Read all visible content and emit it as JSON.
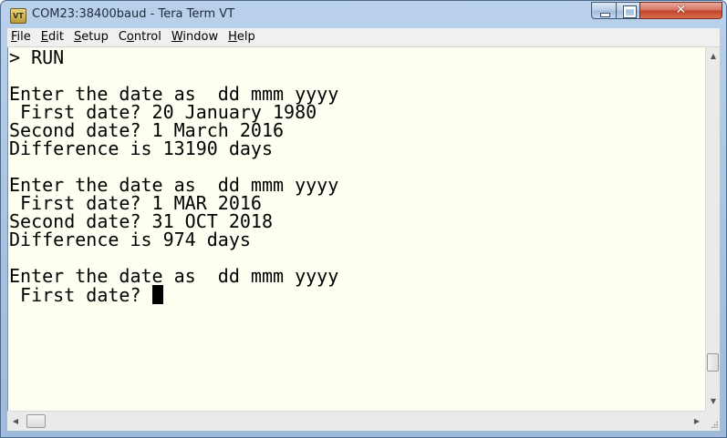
{
  "window": {
    "title": "COM23:38400baud - Tera Term VT",
    "app_icon": "tera-term-icon",
    "icon_text": "VT"
  },
  "caption_buttons": {
    "minimize_icon": "minimize-icon",
    "maximize_icon": "maximize-icon",
    "close_icon": "close-icon",
    "close_glyph": "✕"
  },
  "menu": [
    {
      "accel": "F",
      "rest": "ile"
    },
    {
      "accel": "E",
      "rest": "dit"
    },
    {
      "accel": "S",
      "rest": "etup"
    },
    {
      "pre": "C",
      "accel": "o",
      "rest": "ntrol"
    },
    {
      "accel": "W",
      "rest": "indow"
    },
    {
      "accel": "H",
      "rest": "elp"
    }
  ],
  "terminal": {
    "lines": [
      "> RUN",
      "",
      "Enter the date as  dd mmm yyyy",
      " First date? 20 January 1980",
      "Second date? 1 March 2016",
      "Difference is 13190 days",
      "",
      "Enter the date as  dd mmm yyyy",
      " First date? 1 MAR 2016",
      "Second date? 31 OCT 2018",
      "Difference is 974 days",
      "",
      "Enter the date as  dd mmm yyyy",
      " First date? "
    ],
    "cursor_line": 13
  },
  "scrollbars": {
    "up_glyph": "▲",
    "down_glyph": "▼",
    "left_glyph": "◀",
    "right_glyph": "▶"
  },
  "colors": {
    "terminal_bg": "#fffff2",
    "terminal_fg": "#000000",
    "title_bar": "#b9d1ea",
    "close_button": "#c1432a"
  }
}
